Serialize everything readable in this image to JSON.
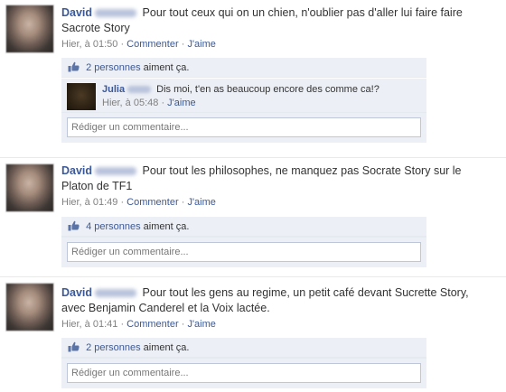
{
  "posts": [
    {
      "author": "David",
      "text": "Pour tout ceux qui on un chien, n'oublier pas d'aller lui faire faire Sacrote Story",
      "time": "Hier, à 01:50",
      "comment_link": "Commenter",
      "like_link": "J'aime",
      "likes_count_link": "2 personnes",
      "likes_suffix": "aiment ça.",
      "comment_placeholder": "Rédiger un commentaire...",
      "comments": [
        {
          "author": "Julia",
          "text": "Dis moi, t'en as beaucoup encore des comme ca!?",
          "time": "Hier, à 05:48",
          "like_link": "J'aime"
        }
      ]
    },
    {
      "author": "David",
      "text": "Pour tout les philosophes, ne manquez pas Socrate Story sur le Platon de TF1",
      "time": "Hier, à 01:49",
      "comment_link": "Commenter",
      "like_link": "J'aime",
      "likes_count_link": "4 personnes",
      "likes_suffix": "aiment ça.",
      "comment_placeholder": "Rédiger un commentaire..."
    },
    {
      "author": "David",
      "text": "Pour tout les gens au regime, un petit café devant Sucrette Story, avec Benjamin Canderel et la Voix lactée.",
      "time": "Hier, à 01:41",
      "comment_link": "Commenter",
      "like_link": "J'aime",
      "likes_count_link": "2 personnes",
      "likes_suffix": "aiment ça.",
      "comment_placeholder": "Rédiger un commentaire..."
    }
  ],
  "separator": "·",
  "colors": {
    "link": "#3b5998",
    "ufi_bg": "#eceff5",
    "meta": "#808080"
  }
}
